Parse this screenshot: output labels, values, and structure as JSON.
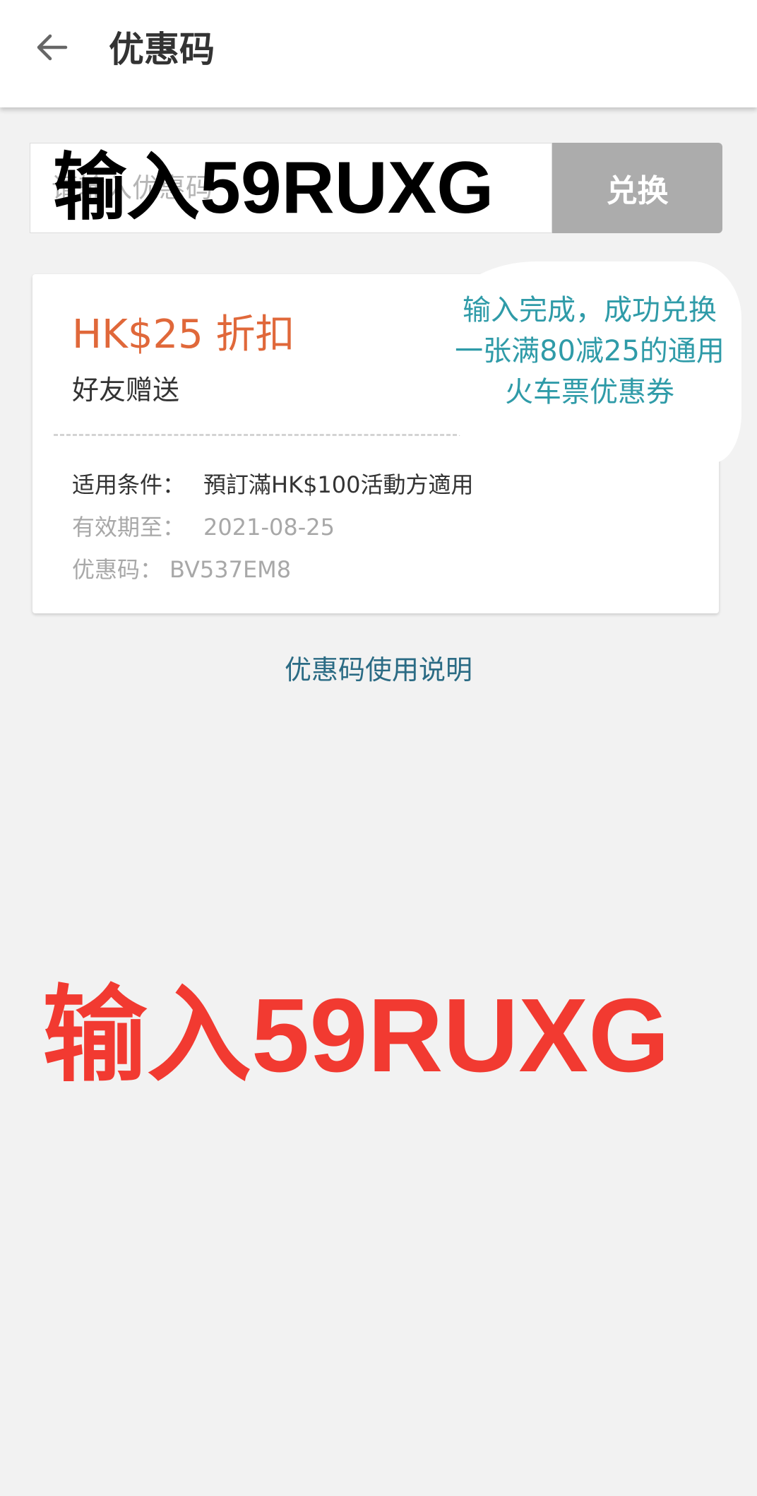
{
  "app_bar": {
    "back_icon": "arrow-left-icon",
    "title": "优惠码"
  },
  "redeem": {
    "placeholder": "请输入优惠码",
    "overlay_text": "输入59RUXG",
    "button_label": "兑换"
  },
  "coupon": {
    "amount": "HK$25 折扣",
    "source": "好友赠送",
    "condition_label": "适用条件：",
    "condition_value": "預訂滿HK$100活動方適用",
    "expiry_label": "有效期至：",
    "expiry_value": "2021-08-25",
    "code_label": "优惠码：",
    "code_value": "BV537EM8"
  },
  "annotation": {
    "bubble_text": "输入完成，成功兑换一张满80减25的通用火车票优惠券",
    "promo_text": "输入59RUXG"
  },
  "help_link": "优惠码使用说明",
  "colors": {
    "accent_orange": "#e0683a",
    "bubble_teal": "#2f9ba8",
    "promo_red": "#f23a31",
    "link_blue": "#2b6b84",
    "button_gray": "#acacac"
  }
}
